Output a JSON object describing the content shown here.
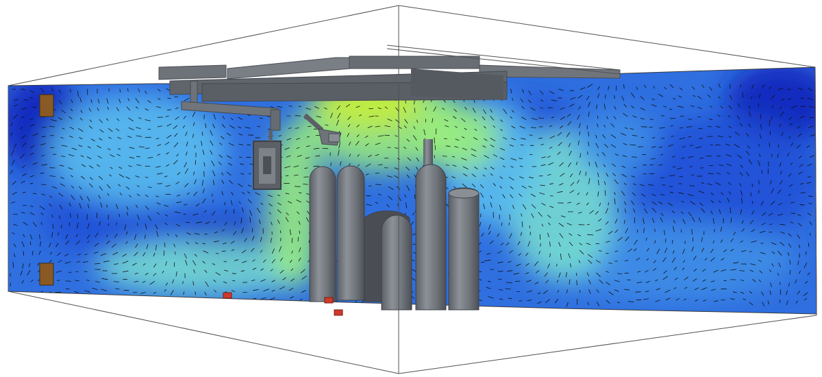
{
  "scene": {
    "kind": "cfd-airflow-visualization",
    "colormap": [
      "#0a1fb8",
      "#1f4fd6",
      "#3f8fe6",
      "#5cc0ee",
      "#79e0d0",
      "#9cf07a",
      "#c8ee3a"
    ],
    "equipment_color": "#737880",
    "wall_markers_color": "#8a5a24",
    "floor_markers_color": "#cf3a2a",
    "outline_color": "#505050",
    "vector_color": "#101010"
  }
}
